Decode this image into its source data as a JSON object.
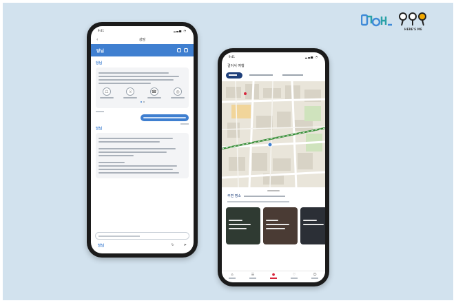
{
  "logos": {
    "logo1_text": "당님",
    "logo2_caption": "HERE'S ME"
  },
  "phone1": {
    "status_time": "9:41",
    "status_icons": "▂▃▅ ◔",
    "title": "상담",
    "back_icon": "‹",
    "header_logo": "당님",
    "bot_logo": "당님",
    "bot_logo2": "당님",
    "quick_icons": [
      "☖",
      "☉",
      "☎",
      "◎"
    ],
    "input_send_icon": "➤",
    "bottom_logo": "당님",
    "bottom_icons": [
      "↻",
      "➤"
    ]
  },
  "phone2": {
    "status_time": "9:41",
    "status_icons": "▂▃▅ ◔",
    "title": "걸어서 여행",
    "sheet_title": "주변 명소",
    "tabs": [
      {
        "icon": "⌂",
        "active": false
      },
      {
        "icon": "☰",
        "active": false
      },
      {
        "icon": "●",
        "active": true
      },
      {
        "icon": "♡",
        "active": false
      },
      {
        "icon": "☺",
        "active": false
      }
    ]
  },
  "colors": {
    "background": "#d2e2ee",
    "chat_blue": "#3f7fd0",
    "navy": "#1e3f7a",
    "map_route": "#3a8f3a",
    "active_tab": "#d7263d"
  }
}
